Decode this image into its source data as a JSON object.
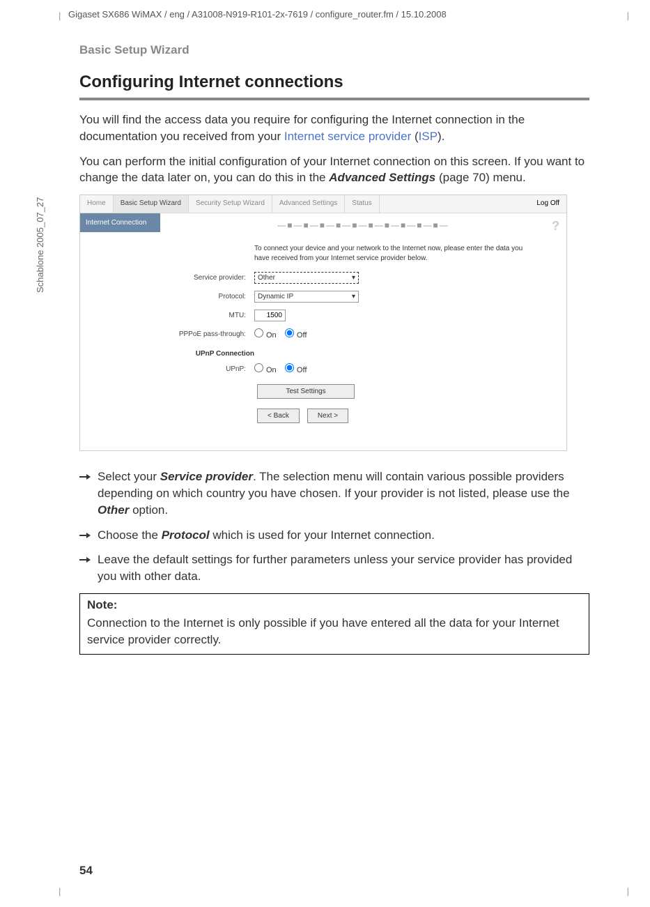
{
  "header_path": "Gigaset SX686 WiMAX / eng / A31008-N919-R101-2x-7619 / configure_router.fm / 15.10.2008",
  "vertical_label": "Schablone 2005_07_27",
  "section_label": "Basic Setup Wizard",
  "title": "Configuring Internet connections",
  "para1_a": "You will find the access data you require for configuring the Internet connection in the documentation you received from your ",
  "para1_link1": "Internet service provider",
  "para1_b": " (",
  "para1_link2": "ISP",
  "para1_c": ").",
  "para2_a": "You can perform the initial configuration of your Internet connection on this screen. If you want to change the data later on, you can do this in the ",
  "para2_bold": "Advanced Settings",
  "para2_b": " (page 70) menu.",
  "ss": {
    "tabs": {
      "home": "Home",
      "basic": "Basic Setup Wizard",
      "security": "Security Setup Wizard",
      "advanced": "Advanced Settings",
      "status": "Status"
    },
    "logoff": "Log Off",
    "side_item": "Internet Connection",
    "stepbar": "—■—■—■—■—■—■—■—■—■—■—",
    "help": "?",
    "intro": "To connect your device and your network to the Internet now, please enter the data you have received from your Internet service provider below.",
    "labels": {
      "provider": "Service provider:",
      "protocol": "Protocol:",
      "mtu": "MTU:",
      "pppoe": "PPPoE pass-through:",
      "upnp_head": "UPnP Connection",
      "upnp": "UPnP:"
    },
    "values": {
      "provider": "Other",
      "protocol": "Dynamic IP",
      "mtu": "1500"
    },
    "radio": {
      "on": "On",
      "off": "Off"
    },
    "buttons": {
      "test": "Test Settings",
      "back": "< Back",
      "next": "Next >"
    }
  },
  "bullets": {
    "b1_a": "Select your ",
    "b1_bold": "Service provider",
    "b1_b": ". The selection menu will contain various possible providers depending on which country you have chosen. If your provider is not listed, please use the ",
    "b1_bold2": "Other",
    "b1_c": " option.",
    "b2_a": "Choose the ",
    "b2_bold": "Protocol",
    "b2_b": " which is used for your Internet connection.",
    "b3": "Leave the default settings for further parameters unless your service provider has provided you with other data."
  },
  "note": {
    "head": "Note:",
    "body": "Connection to the Internet is only possible if you have entered all the data for your Internet service provider correctly."
  },
  "page_num": "54"
}
